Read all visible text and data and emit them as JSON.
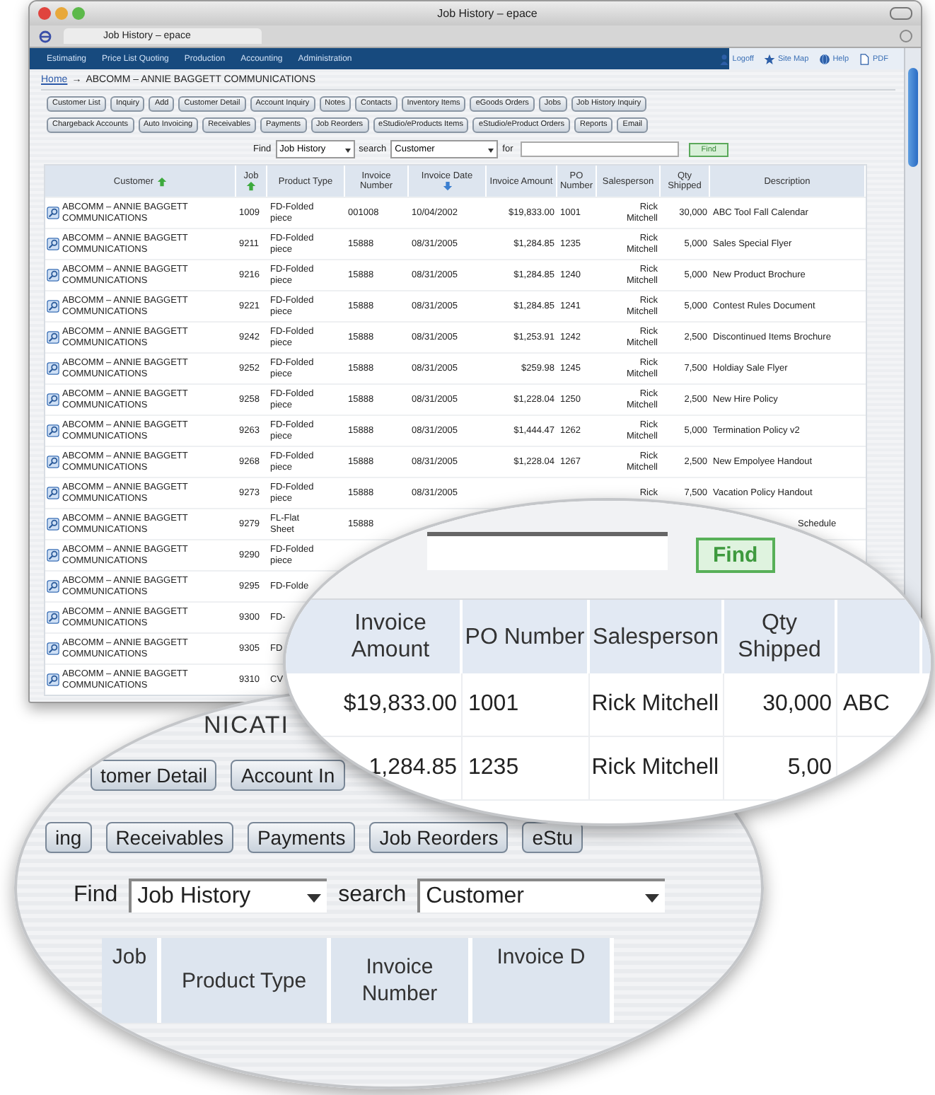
{
  "window": {
    "title": "Job History – epace"
  },
  "browser_tab": {
    "title": "Job History – epace"
  },
  "nav": {
    "items": [
      "Estimating",
      "Price List Quoting",
      "Production",
      "Accounting",
      "Administration"
    ],
    "links": [
      {
        "label": "Logoff"
      },
      {
        "label": "Site Map"
      },
      {
        "label": "Help"
      },
      {
        "label": "PDF"
      }
    ]
  },
  "breadcrumb": {
    "home": "Home",
    "separator": "→",
    "current": "ABCOMM – ANNIE BAGGETT COMMUNICATIONS"
  },
  "button_rows": [
    [
      "Customer List",
      "Inquiry",
      "Add",
      "Customer Detail",
      "Account Inquiry",
      "Notes",
      "Contacts",
      "Inventory Items",
      "eGoods Orders",
      "Jobs",
      "Job History Inquiry"
    ],
    [
      "Chargeback Accounts",
      "Auto Invoicing",
      "Receivables",
      "Payments",
      "Job Reorders",
      "eStudio/eProducts Items",
      "eStudio/eProduct Orders",
      "Reports",
      "Email"
    ]
  ],
  "find": {
    "label": "Find",
    "type": "Job History",
    "search_label": "search",
    "search_field": "Customer",
    "for_label": "for",
    "button": "Find"
  },
  "table": {
    "columns": [
      {
        "label": "Customer",
        "sorted": true,
        "descending": false
      },
      {
        "label": "Job",
        "sorted": true,
        "descending": false
      },
      {
        "label": "Product Type",
        "sorted": false
      },
      {
        "label": "Invoice Number",
        "sorted": false
      },
      {
        "label": "Invoice Date",
        "sorted": true,
        "descending": true
      },
      {
        "label": "Invoice Amount",
        "sorted": false
      },
      {
        "label": "PO Number",
        "sorted": false
      },
      {
        "label": "Salesperson",
        "sorted": false
      },
      {
        "label": "Qty Shipped",
        "sorted": false
      },
      {
        "label": "Description",
        "sorted": false
      }
    ],
    "rows": [
      {
        "customer": "ABCOMM – ANNIE BAGGETT COMMUNICATIONS",
        "job": "1009",
        "product_type": "FD-Folded piece",
        "invoice_number": "001008",
        "invoice_date": "10/04/2002",
        "invoice_amount": "$19,833.00",
        "po_number": "1001",
        "salesperson": "Rick Mitchell",
        "qty_shipped": "30,000",
        "description": "ABC Tool Fall Calendar"
      },
      {
        "customer": "ABCOMM – ANNIE BAGGETT COMMUNICATIONS",
        "job": "9211",
        "product_type": "FD-Folded piece",
        "invoice_number": "15888",
        "invoice_date": "08/31/2005",
        "invoice_amount": "$1,284.85",
        "po_number": "1235",
        "salesperson": "Rick Mitchell",
        "qty_shipped": "5,000",
        "description": "Sales Special Flyer"
      },
      {
        "customer": "ABCOMM – ANNIE BAGGETT COMMUNICATIONS",
        "job": "9216",
        "product_type": "FD-Folded piece",
        "invoice_number": "15888",
        "invoice_date": "08/31/2005",
        "invoice_amount": "$1,284.85",
        "po_number": "1240",
        "salesperson": "Rick Mitchell",
        "qty_shipped": "5,000",
        "description": "New Product Brochure"
      },
      {
        "customer": "ABCOMM – ANNIE BAGGETT COMMUNICATIONS",
        "job": "9221",
        "product_type": "FD-Folded piece",
        "invoice_number": "15888",
        "invoice_date": "08/31/2005",
        "invoice_amount": "$1,284.85",
        "po_number": "1241",
        "salesperson": "Rick Mitchell",
        "qty_shipped": "5,000",
        "description": "Contest Rules Document"
      },
      {
        "customer": "ABCOMM – ANNIE BAGGETT COMMUNICATIONS",
        "job": "9242",
        "product_type": "FD-Folded piece",
        "invoice_number": "15888",
        "invoice_date": "08/31/2005",
        "invoice_amount": "$1,253.91",
        "po_number": "1242",
        "salesperson": "Rick Mitchell",
        "qty_shipped": "2,500",
        "description": "Discontinued Items Brochure"
      },
      {
        "customer": "ABCOMM – ANNIE BAGGETT COMMUNICATIONS",
        "job": "9252",
        "product_type": "FD-Folded piece",
        "invoice_number": "15888",
        "invoice_date": "08/31/2005",
        "invoice_amount": "$259.98",
        "po_number": "1245",
        "salesperson": "Rick Mitchell",
        "qty_shipped": "7,500",
        "description": "Holdiay Sale Flyer"
      },
      {
        "customer": "ABCOMM – ANNIE BAGGETT COMMUNICATIONS",
        "job": "9258",
        "product_type": "FD-Folded piece",
        "invoice_number": "15888",
        "invoice_date": "08/31/2005",
        "invoice_amount": "$1,228.04",
        "po_number": "1250",
        "salesperson": "Rick Mitchell",
        "qty_shipped": "2,500",
        "description": "New Hire Policy"
      },
      {
        "customer": "ABCOMM – ANNIE BAGGETT COMMUNICATIONS",
        "job": "9263",
        "product_type": "FD-Folded piece",
        "invoice_number": "15888",
        "invoice_date": "08/31/2005",
        "invoice_amount": "$1,444.47",
        "po_number": "1262",
        "salesperson": "Rick Mitchell",
        "qty_shipped": "5,000",
        "description": "Termination Policy v2"
      },
      {
        "customer": "ABCOMM – ANNIE BAGGETT COMMUNICATIONS",
        "job": "9268",
        "product_type": "FD-Folded piece",
        "invoice_number": "15888",
        "invoice_date": "08/31/2005",
        "invoice_amount": "$1,228.04",
        "po_number": "1267",
        "salesperson": "Rick Mitchell",
        "qty_shipped": "2,500",
        "description": "New Empolyee Handout"
      },
      {
        "customer": "ABCOMM – ANNIE BAGGETT COMMUNICATIONS",
        "job": "9273",
        "product_type": "FD-Folded piece",
        "invoice_number": "15888",
        "invoice_date": "08/31/2005",
        "salesperson": "Rick",
        "qty_shipped": "7,500",
        "description": "Vacation Policy Handout"
      },
      {
        "customer": "ABCOMM – ANNIE BAGGETT COMMUNICATIONS",
        "job": "9279",
        "product_type": "FL-Flat Sheet",
        "invoice_number": "15888",
        "description": "Schedule"
      },
      {
        "customer": "ABCOMM – ANNIE BAGGETT COMMUNICATIONS",
        "job": "9290",
        "product_type": "FD-Folded piece"
      },
      {
        "customer": "ABCOMM – ANNIE BAGGETT COMMUNICATIONS",
        "job": "9295",
        "product_type": "FD-Folde"
      },
      {
        "customer": "ABCOMM – ANNIE BAGGETT COMMUNICATIONS",
        "job": "9300",
        "product_type": "FD-"
      },
      {
        "customer": "ABCOMM – ANNIE BAGGETT COMMUNICATIONS",
        "job": "9305",
        "product_type": "FD"
      },
      {
        "customer": "ABCOMM – ANNIE BAGGETT COMMUNICATIONS",
        "job": "9310",
        "product_type": "CV"
      }
    ]
  },
  "magnifier_top": {
    "find_button": "Find",
    "columns": [
      "Invoice Amount",
      "PO Number",
      "Salesperson",
      "Qty Shipped"
    ],
    "rows": [
      {
        "invoice_amount": "$19,833.00",
        "po_number": "1001",
        "salesperson": "Rick Mitchell",
        "qty_shipped": "30,000",
        "description": "ABC"
      },
      {
        "invoice_amount": "1,284.85",
        "po_number": "1235",
        "salesperson": "Rick Mitchell",
        "qty_shipped": "5,00"
      }
    ]
  },
  "magnifier_bottom": {
    "heading_fragment": "NICATI",
    "button_rows": [
      [
        "tomer Detail",
        "Account In"
      ],
      [
        "ing",
        "Receivables",
        "Payments",
        "Job Reorders",
        "eStu"
      ]
    ],
    "find": {
      "label": "Find",
      "type": "Job History",
      "search_label": "search",
      "search_field": "Customer"
    },
    "columns": [
      "Job",
      "Product Type",
      "Invoice Number",
      "Invoice D"
    ]
  }
}
